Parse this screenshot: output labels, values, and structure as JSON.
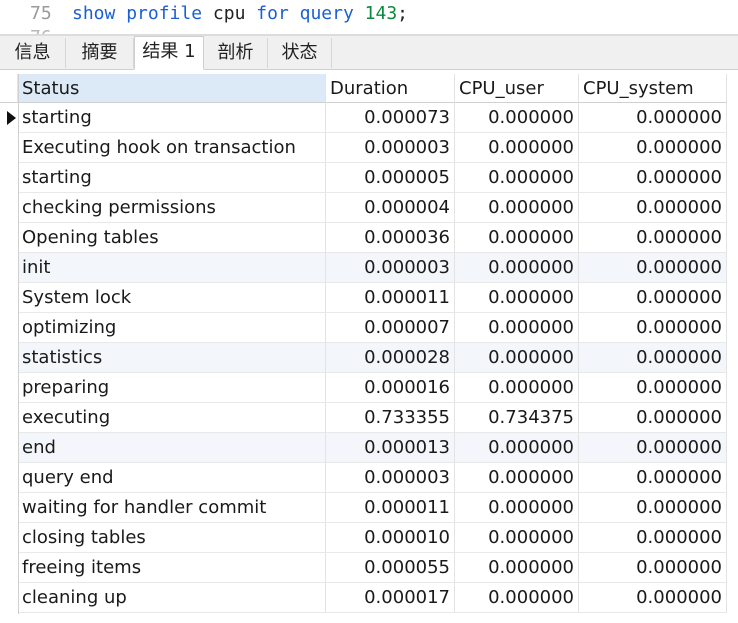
{
  "editor": {
    "line_number": "75",
    "next_line_number": "76",
    "tokens": {
      "kw1": "show",
      "kw2": "profile",
      "plain1": "cpu",
      "kw3": "for",
      "kw4": "query",
      "num": "143",
      "semi": ";"
    }
  },
  "tabs": [
    {
      "label": "信息"
    },
    {
      "label": "摘要"
    },
    {
      "label": "结果 1",
      "active": true
    },
    {
      "label": "剖析"
    },
    {
      "label": "状态"
    }
  ],
  "table": {
    "headers": [
      "Status",
      "Duration",
      "CPU_user",
      "CPU_system"
    ],
    "rows": [
      [
        "starting",
        "0.000073",
        "0.000000",
        "0.000000"
      ],
      [
        "Executing hook on transaction",
        "0.000003",
        "0.000000",
        "0.000000"
      ],
      [
        "starting",
        "0.000005",
        "0.000000",
        "0.000000"
      ],
      [
        "checking permissions",
        "0.000004",
        "0.000000",
        "0.000000"
      ],
      [
        "Opening tables",
        "0.000036",
        "0.000000",
        "0.000000"
      ],
      [
        "init",
        "0.000003",
        "0.000000",
        "0.000000"
      ],
      [
        "System lock",
        "0.000011",
        "0.000000",
        "0.000000"
      ],
      [
        "optimizing",
        "0.000007",
        "0.000000",
        "0.000000"
      ],
      [
        "statistics",
        "0.000028",
        "0.000000",
        "0.000000"
      ],
      [
        "preparing",
        "0.000016",
        "0.000000",
        "0.000000"
      ],
      [
        "executing",
        "0.733355",
        "0.734375",
        "0.000000"
      ],
      [
        "end",
        "0.000013",
        "0.000000",
        "0.000000"
      ],
      [
        "query end",
        "0.000003",
        "0.000000",
        "0.000000"
      ],
      [
        "waiting for handler commit",
        "0.000011",
        "0.000000",
        "0.000000"
      ],
      [
        "closing tables",
        "0.000010",
        "0.000000",
        "0.000000"
      ],
      [
        "freeing items",
        "0.000055",
        "0.000000",
        "0.000000"
      ],
      [
        "cleaning up",
        "0.000017",
        "0.000000",
        "0.000000"
      ]
    ],
    "current_row_indicator": "row-pointer-icon",
    "colors": {
      "header_selected": "#dce9f7",
      "alt_row": "#f3f7fc"
    }
  }
}
